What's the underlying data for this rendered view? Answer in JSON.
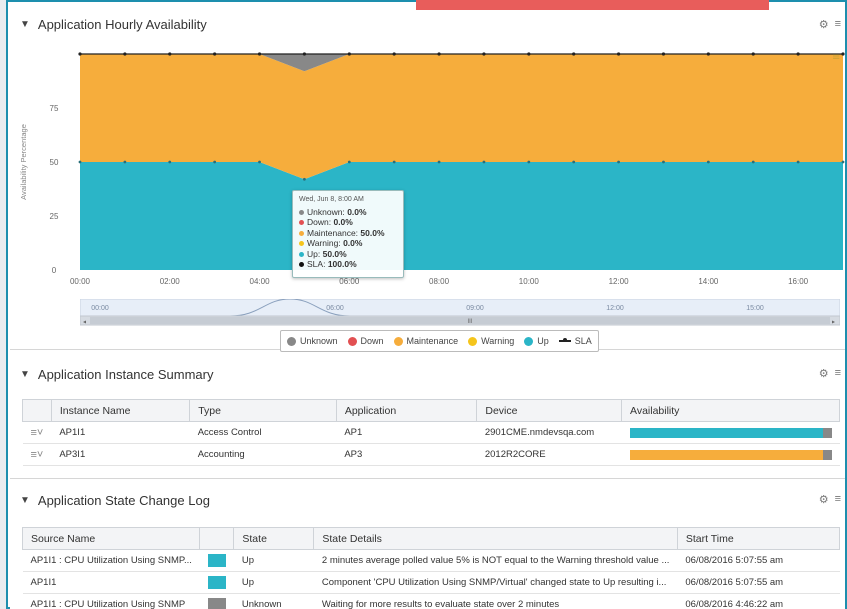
{
  "colors": {
    "up": "#2bb5c7",
    "maintenance": "#f6ad3c",
    "warning": "#f5c51c",
    "down": "#e25052",
    "unknown": "#888888",
    "frame": "#1d8fae"
  },
  "panels": {
    "availability": {
      "title": "Application Hourly Availability"
    },
    "summary": {
      "title": "Application Instance Summary"
    },
    "log": {
      "title": "Application State Change Log"
    }
  },
  "icons": {
    "gear": "gear-icon",
    "menu": "menu-icon",
    "chevron": "chevron-down-icon"
  },
  "chart_data": {
    "type": "area",
    "ylabel": "Availability Percentage",
    "y_ticks": [
      "0",
      "25",
      "50",
      "75"
    ],
    "ylim": [
      0,
      100
    ],
    "x_ticks": [
      "00:00",
      "02:00",
      "04:00",
      "06:00",
      "08:00",
      "10:00",
      "12:00",
      "14:00",
      "16:00"
    ],
    "x": [
      "00:00",
      "01:00",
      "02:00",
      "03:00",
      "04:00",
      "05:00",
      "06:00",
      "07:00",
      "08:00",
      "09:00",
      "10:00",
      "11:00",
      "12:00",
      "13:00",
      "14:00",
      "15:00",
      "16:00",
      "17:00"
    ],
    "series": [
      {
        "name": "Up",
        "color": "#2bb5c7",
        "values": [
          50,
          50,
          50,
          50,
          50,
          42,
          50,
          50,
          50,
          50,
          50,
          50,
          50,
          50,
          50,
          50,
          50,
          50
        ]
      },
      {
        "name": "Maintenance",
        "color": "#f6ad3c",
        "values": [
          50,
          50,
          50,
          50,
          50,
          50,
          50,
          50,
          50,
          50,
          50,
          50,
          50,
          50,
          50,
          50,
          50,
          50
        ]
      },
      {
        "name": "Unknown",
        "color": "#888888",
        "values": [
          0,
          0,
          0,
          0,
          0,
          8,
          0,
          0,
          0,
          0,
          0,
          0,
          0,
          0,
          0,
          0,
          0,
          0
        ]
      },
      {
        "name": "Down",
        "color": "#e25052",
        "values": [
          0,
          0,
          0,
          0,
          0,
          0,
          0,
          0,
          0,
          0,
          0,
          0,
          0,
          0,
          0,
          0,
          0,
          0
        ]
      },
      {
        "name": "Warning",
        "color": "#f5c51c",
        "values": [
          0,
          0,
          0,
          0,
          0,
          0,
          0,
          0,
          0,
          0,
          0,
          0,
          0,
          0,
          0,
          0,
          0,
          0
        ]
      }
    ],
    "sla": {
      "name": "SLA",
      "value": 100
    },
    "navigator_ticks": [
      "00:00",
      "06:00",
      "09:00",
      "12:00",
      "15:00"
    ],
    "navigator_handle": "III",
    "legend": [
      "Unknown",
      "Down",
      "Maintenance",
      "Warning",
      "Up",
      "SLA"
    ],
    "legend_position": "bottom-center"
  },
  "tooltip": {
    "title": "Wed, Jun 8, 8:00 AM",
    "rows": [
      {
        "label": "Unknown:",
        "value": "0.0%",
        "color": "#888888"
      },
      {
        "label": "Down:",
        "value": "0.0%",
        "color": "#e25052"
      },
      {
        "label": "Maintenance:",
        "value": "50.0%",
        "color": "#f6ad3c"
      },
      {
        "label": "Warning:",
        "value": "0.0%",
        "color": "#f5c51c"
      },
      {
        "label": "Up:",
        "value": "50.0%",
        "color": "#2bb5c7"
      },
      {
        "label": "SLA:",
        "value": "100.0%",
        "color": "#111111"
      }
    ]
  },
  "summary_table": {
    "headers": [
      "Instance Name",
      "Type",
      "Application",
      "Device",
      "Availability"
    ],
    "rows": [
      {
        "instance": "AP1I1",
        "type": "Access Control",
        "application": "AP1",
        "device": "2901CME.nmdevsqa.com",
        "availability_pct": 96,
        "bar_color": "#2bb5c7"
      },
      {
        "instance": "AP3I1",
        "type": "Accounting",
        "application": "AP3",
        "device": "2012R2CORE",
        "availability_pct": 96,
        "bar_color": "#f6ad3c"
      }
    ]
  },
  "log_table": {
    "headers": [
      "Source Name",
      "",
      "State",
      "State Details",
      "Start Time"
    ],
    "rows": [
      {
        "source": "AP1I1 : CPU Utilization Using SNMP...",
        "state": "Up",
        "state_color": "#2bb5c7",
        "details": "2 minutes average polled value 5% is NOT equal to the Warning threshold value ...",
        "start": "06/08/2016 5:07:55 am"
      },
      {
        "source": "AP1I1",
        "state": "Up",
        "state_color": "#2bb5c7",
        "details": "Component 'CPU Utilization Using SNMP/Virtual' changed state to Up resulting i...",
        "start": "06/08/2016 5:07:55 am"
      },
      {
        "source": "AP1I1 : CPU Utilization Using SNMP",
        "state": "Unknown",
        "state_color": "#888888",
        "details": "Waiting for more results to evaluate state over 2 minutes",
        "start": "06/08/2016 4:46:22 am"
      }
    ]
  }
}
